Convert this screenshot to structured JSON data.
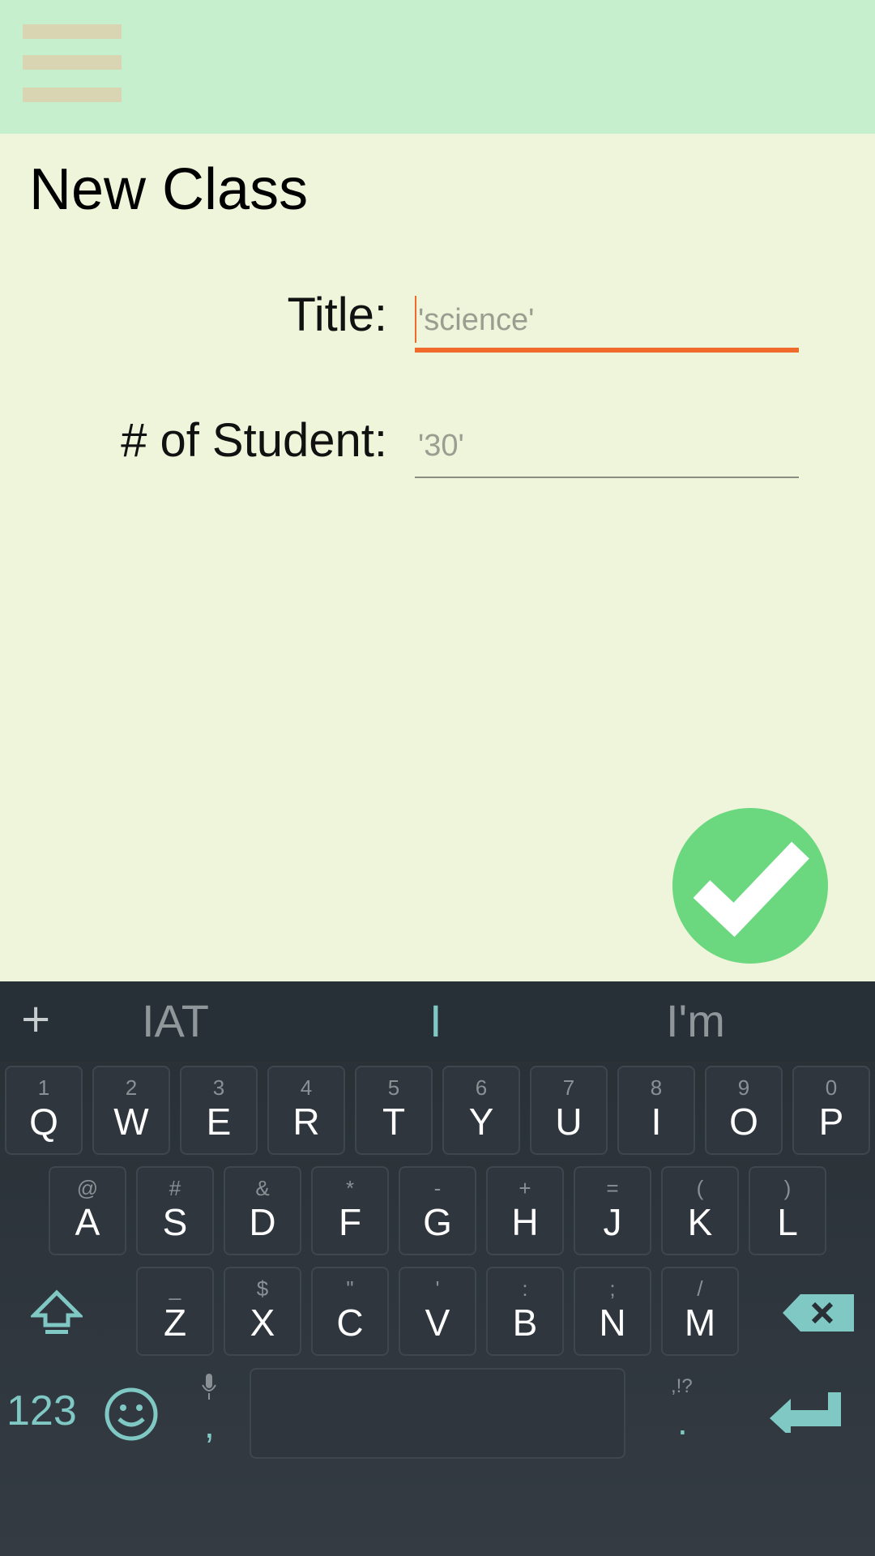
{
  "page": {
    "title": "New Class"
  },
  "form": {
    "title_label": "Title:",
    "title_placeholder": "'science'",
    "students_label": "# of Student:",
    "students_placeholder": "'30'"
  },
  "keyboard": {
    "suggestions": [
      "IAT",
      "I",
      "I'm"
    ],
    "plus": "+",
    "row1": [
      {
        "hint": "1",
        "key": "Q"
      },
      {
        "hint": "2",
        "key": "W"
      },
      {
        "hint": "3",
        "key": "E"
      },
      {
        "hint": "4",
        "key": "R"
      },
      {
        "hint": "5",
        "key": "T"
      },
      {
        "hint": "6",
        "key": "Y"
      },
      {
        "hint": "7",
        "key": "U"
      },
      {
        "hint": "8",
        "key": "I"
      },
      {
        "hint": "9",
        "key": "O"
      },
      {
        "hint": "0",
        "key": "P"
      }
    ],
    "row2": [
      {
        "hint": "@",
        "key": "A"
      },
      {
        "hint": "#",
        "key": "S"
      },
      {
        "hint": "&",
        "key": "D"
      },
      {
        "hint": "*",
        "key": "F"
      },
      {
        "hint": "-",
        "key": "G"
      },
      {
        "hint": "+",
        "key": "H"
      },
      {
        "hint": "=",
        "key": "J"
      },
      {
        "hint": "(",
        "key": "K"
      },
      {
        "hint": ")",
        "key": "L"
      }
    ],
    "row3": [
      {
        "hint": "_",
        "key": "Z"
      },
      {
        "hint": "$",
        "key": "X"
      },
      {
        "hint": "\"",
        "key": "C"
      },
      {
        "hint": "'",
        "key": "V"
      },
      {
        "hint": ":",
        "key": "B"
      },
      {
        "hint": ";",
        "key": "N"
      },
      {
        "hint": "/",
        "key": "M"
      }
    ],
    "numbers_label": "123",
    "comma": ",",
    "period": ".",
    "period_hint": ",!?"
  },
  "colors": {
    "accent": "#f06a2b",
    "fab": "#6bd880",
    "keyboard_accent": "#7fc8c4"
  }
}
